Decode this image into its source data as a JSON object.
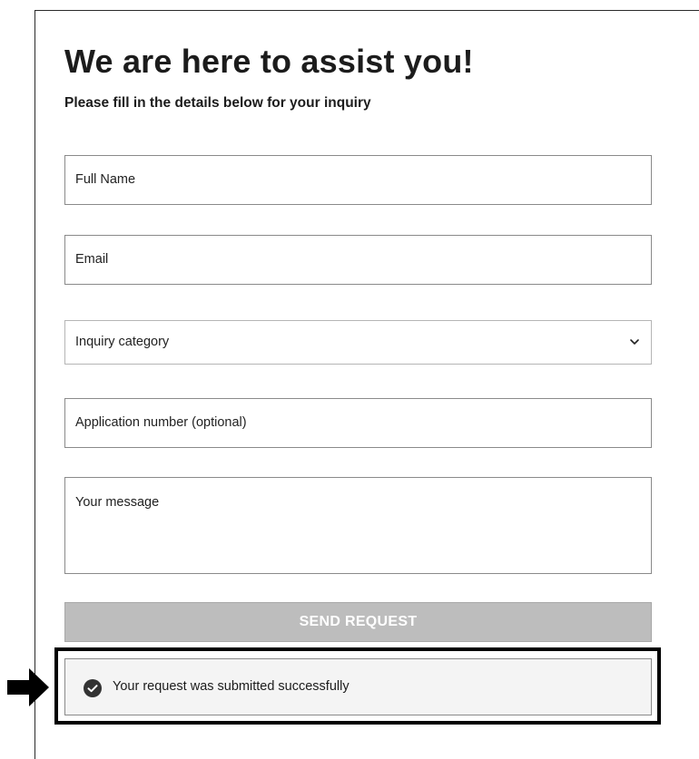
{
  "form": {
    "title": "We are here to assist you!",
    "subtitle": "Please fill in the details below for your inquiry",
    "full_name_placeholder": "Full Name",
    "email_placeholder": "Email",
    "inquiry_category_selected": "Inquiry category",
    "application_number_placeholder": "Application number (optional)",
    "message_placeholder": "Your message",
    "send_label": "SEND REQUEST"
  },
  "success": {
    "message": "Your request was submitted successfully",
    "icon": "check-circle-icon"
  },
  "annotation": {
    "icon": "arrow-right-icon"
  },
  "colors": {
    "button_disabled": "#bdbdbd",
    "highlight_border": "#000000",
    "success_bg": "#f4f4f4"
  }
}
